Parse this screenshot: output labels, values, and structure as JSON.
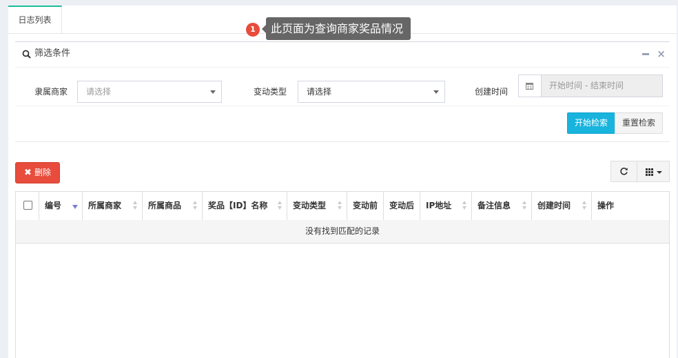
{
  "tabs": [
    {
      "label": "日志列表"
    }
  ],
  "tooltip": {
    "badge": "1",
    "text": "此页面为查询商家奖品情况"
  },
  "filter": {
    "title": "筛选条件",
    "merchant_label": "隶属商家",
    "merchant_placeholder": "请选择",
    "change_type_label": "变动类型",
    "change_type_value": "请选择",
    "created_label": "创建时间",
    "date_placeholder": "开始时间 - 结束时间",
    "search_button": "开始检索",
    "reset_button": "重置检索"
  },
  "toolbar": {
    "delete_label": "删除"
  },
  "table": {
    "columns": [
      "编号",
      "所属商家",
      "所属商品",
      "奖品【ID】名称",
      "变动类型",
      "变动前",
      "变动后",
      "IP地址",
      "备注信息",
      "创建时间",
      "操作"
    ],
    "empty_text": "没有找到匹配的记录"
  },
  "colors": {
    "primary": "#18b4dd",
    "danger": "#e74c3c",
    "tab_accent": "#18bc9c"
  }
}
